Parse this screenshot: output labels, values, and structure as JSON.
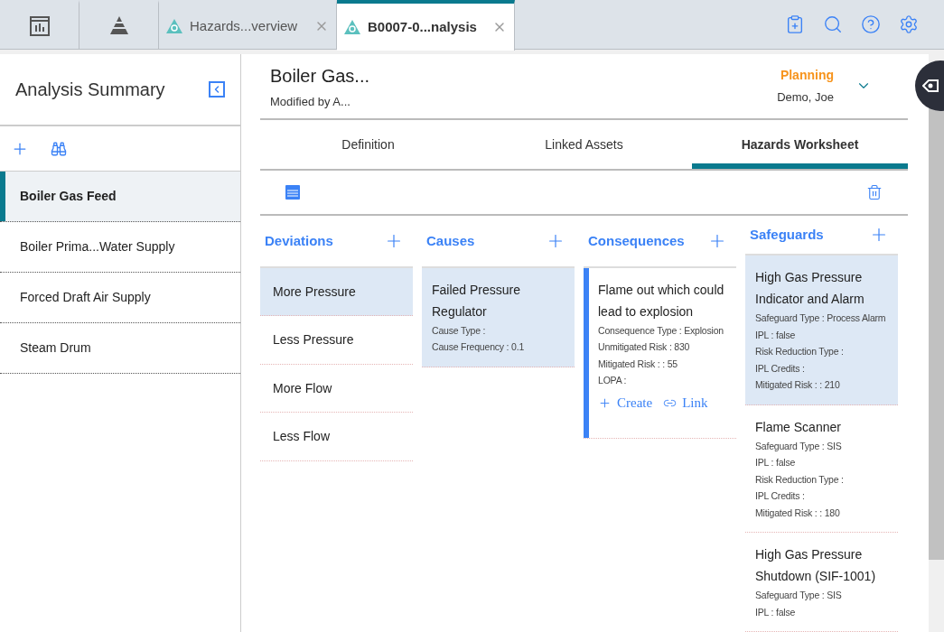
{
  "top_tabs": [
    {
      "kind": "dashboard",
      "selected": false
    },
    {
      "kind": "pyramid",
      "selected": false
    },
    {
      "kind": "doc",
      "label": "Hazards...verview",
      "selected": false
    },
    {
      "kind": "doc",
      "label": "B0007-0...nalysis",
      "selected": true
    }
  ],
  "sidebar": {
    "title": "Analysis Summary",
    "items": [
      {
        "label": "Boiler Gas Feed",
        "selected": true
      },
      {
        "label": "Boiler Prima...Water Supply",
        "selected": false
      },
      {
        "label": "Forced Draft Air Supply",
        "selected": false
      },
      {
        "label": "Steam Drum",
        "selected": false
      }
    ]
  },
  "header": {
    "title": "Boiler Gas...",
    "subtitle": "Modified by A...",
    "state": "Planning",
    "owner": "Demo, Joe"
  },
  "tabs": [
    {
      "label": "Definition",
      "selected": false
    },
    {
      "label": "Linked Assets",
      "selected": false
    },
    {
      "label": "Hazards Worksheet",
      "selected": true
    }
  ],
  "columns": [
    {
      "title": "Deviations",
      "kind": "list",
      "items": [
        {
          "title": "More Pressure",
          "selected": true
        },
        {
          "title": "Less Pressure",
          "selected": false
        },
        {
          "title": "More Flow",
          "selected": false
        },
        {
          "title": "Less Flow",
          "selected": false
        }
      ]
    },
    {
      "title": "Causes",
      "kind": "cards",
      "items": [
        {
          "title": "Failed Pressure Regulator",
          "selected": true,
          "focused": false,
          "fields": [
            "Cause Type :",
            "Cause Frequency : 0.1"
          ]
        }
      ]
    },
    {
      "title": "Consequences",
      "kind": "cards",
      "items": [
        {
          "title": "Flame out which could lead to explosion",
          "selected": false,
          "focused": true,
          "fields": [
            "Consequence Type : Explosion",
            "Unmitigated Risk : 830",
            "Mitigated Risk : : 55",
            "LOPA :"
          ],
          "actions": [
            {
              "kind": "create",
              "label": "Create"
            },
            {
              "kind": "link",
              "label": "Link"
            }
          ]
        }
      ]
    },
    {
      "title": "Safeguards",
      "kind": "cards",
      "items": [
        {
          "title": "High Gas Pressure Indicator and Alarm",
          "selected": true,
          "focused": false,
          "fields": [
            "Safeguard Type : Process Alarm",
            "IPL : false",
            "Risk Reduction Type :",
            "IPL Credits :",
            "Mitigated Risk : : 210"
          ]
        },
        {
          "title": "Flame Scanner",
          "selected": false,
          "focused": false,
          "fields": [
            "Safeguard Type : SIS",
            "IPL : false",
            "Risk Reduction Type :",
            "IPL Credits :",
            "Mitigated Risk : : 180"
          ]
        },
        {
          "title": "High Gas Pressure Shutdown (SIF-1001)",
          "selected": false,
          "focused": false,
          "fields": [
            "Safeguard Type : SIS",
            "IPL : false"
          ]
        }
      ]
    }
  ]
}
